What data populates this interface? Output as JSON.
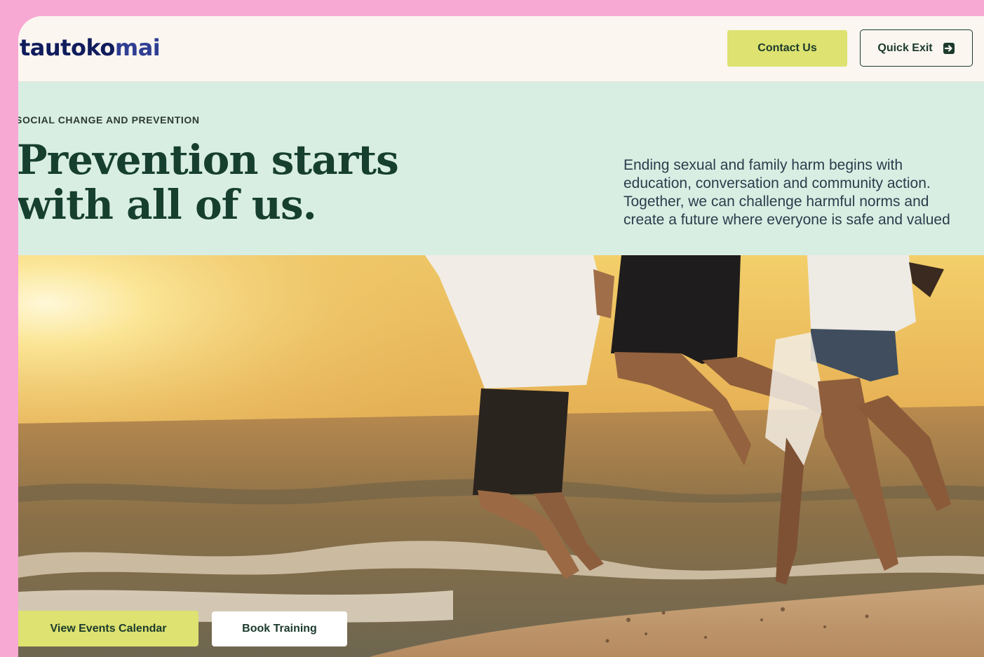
{
  "header": {
    "logo_part1": "tautoko",
    "logo_part2": "mai",
    "contact_label": "Contact Us",
    "quick_exit_label": "Quick Exit"
  },
  "hero": {
    "eyebrow": "SOCIAL CHANGE AND PREVENTION",
    "headline_line1": "Prevention starts",
    "headline_line2": "with all of us.",
    "intro_lines": [
      "Ending sexual and family harm begins with",
      "education, conversation and community action.",
      "Together, we can challenge harmful norms and",
      "create a future where everyone is safe and valued"
    ],
    "image_icon": "beach-sunset-photo"
  },
  "actions": {
    "events_label": "View Events Calendar",
    "training_label": "Book Training"
  },
  "colors": {
    "page_bg": "#f7a9d4",
    "header_bg": "#fbf6f0",
    "band_bg": "#d9eee3",
    "accent_yellow": "#dde270",
    "headline_green": "#163f2f",
    "logo_navy": "#101c5c"
  }
}
